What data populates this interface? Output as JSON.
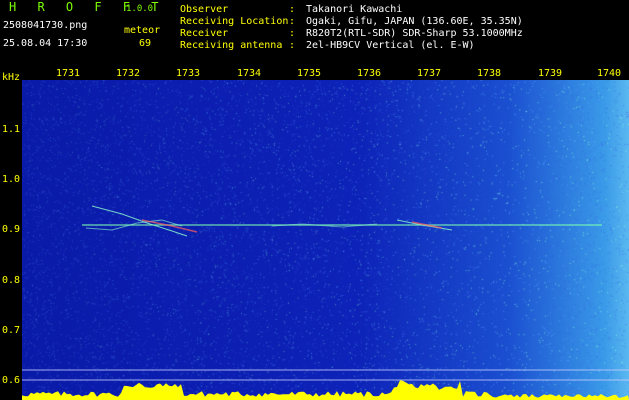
{
  "header": {
    "brand": "H R O F F T",
    "version": "1.0.0",
    "filename": "2508041730.png",
    "timestamp": "25.08.04 17:30",
    "meteor_label": "meteor",
    "meteor_count": "69",
    "info": [
      {
        "label": "Observer",
        "value": "Takanori Kawachi"
      },
      {
        "label": "Receiving Location",
        "value": "Ogaki, Gifu, JAPAN (136.60E, 35.35N)"
      },
      {
        "label": "Receiver",
        "value": "R820T2(RTL-SDR) SDR-Sharp 53.1000MHz"
      },
      {
        "label": "Receiving antenna",
        "value": "2el-HB9CV Vertical (el. E-W)"
      }
    ]
  },
  "spectrogram": {
    "unit": "kHz",
    "x_ticks": [
      "1731",
      "1732",
      "1733",
      "1734",
      "1735",
      "1736",
      "1737",
      "1738",
      "1739",
      "1740"
    ],
    "y_ticks": [
      "1.1",
      "1.0",
      "0.9",
      "0.8",
      "0.7",
      "0.6"
    ]
  },
  "colors": {
    "text_green": "#7CFC00",
    "text_yellow": "#FFFF00",
    "text_white": "#FFFFFF",
    "background_blue": "#0d22b8",
    "carrier_line": "#7cffb0",
    "signal_floor": "#FFFF00"
  }
}
